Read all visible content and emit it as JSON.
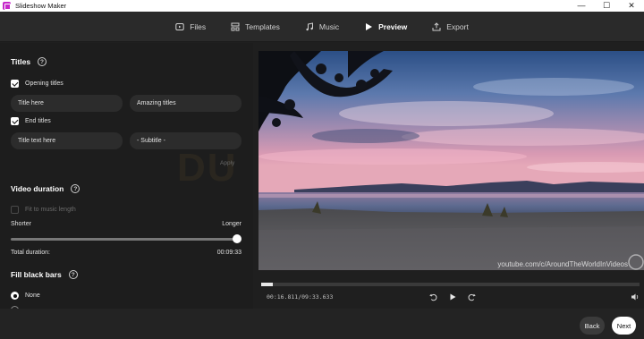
{
  "window": {
    "title": "Slideshow Maker",
    "controls": [
      "—",
      "☐",
      "✕"
    ]
  },
  "nav": {
    "tabs": [
      {
        "label": "Files",
        "icon": "files-icon",
        "active": false
      },
      {
        "label": "Templates",
        "icon": "templates-icon",
        "active": false
      },
      {
        "label": "Music",
        "icon": "music-icon",
        "active": false
      },
      {
        "label": "Preview",
        "icon": "play-icon",
        "active": true
      },
      {
        "label": "Export",
        "icon": "export-icon",
        "active": false
      }
    ]
  },
  "titles": {
    "heading": "Titles",
    "help": "?",
    "opening": {
      "label": "Opening titles",
      "checked": true,
      "title_value": "Title here",
      "subtitle_value": "Amazing titles"
    },
    "end": {
      "label": "End titles",
      "checked": true,
      "title_value": "Title text here",
      "subtitle_value": "- Subtitle -"
    },
    "apply": "Apply"
  },
  "video_duration": {
    "heading": "Video duration",
    "help": "?",
    "fit_to_music": {
      "label": "Fit to music length",
      "checked": false,
      "enabled": false
    },
    "shorter": "Shorter",
    "longer": "Longer",
    "slider_level": 1.0,
    "total_label": "Total duration:",
    "total_value": "00:09:33"
  },
  "fill_black_bars": {
    "heading": "Fill black bars",
    "help": "?",
    "options": [
      {
        "label": "None",
        "selected": true
      }
    ]
  },
  "watermark": "DU",
  "preview": {
    "overlay_text": "youtube.com/c/AroundTheWorldInVideos"
  },
  "player": {
    "time": "00:16.811/09:33.633",
    "progress": 0.03,
    "rewind_icon": "rewind-icon",
    "play_icon": "play-icon",
    "forward_icon": "forward-icon",
    "volume_icon": "volume-icon"
  },
  "footer": {
    "back": "Back",
    "next": "Next"
  }
}
